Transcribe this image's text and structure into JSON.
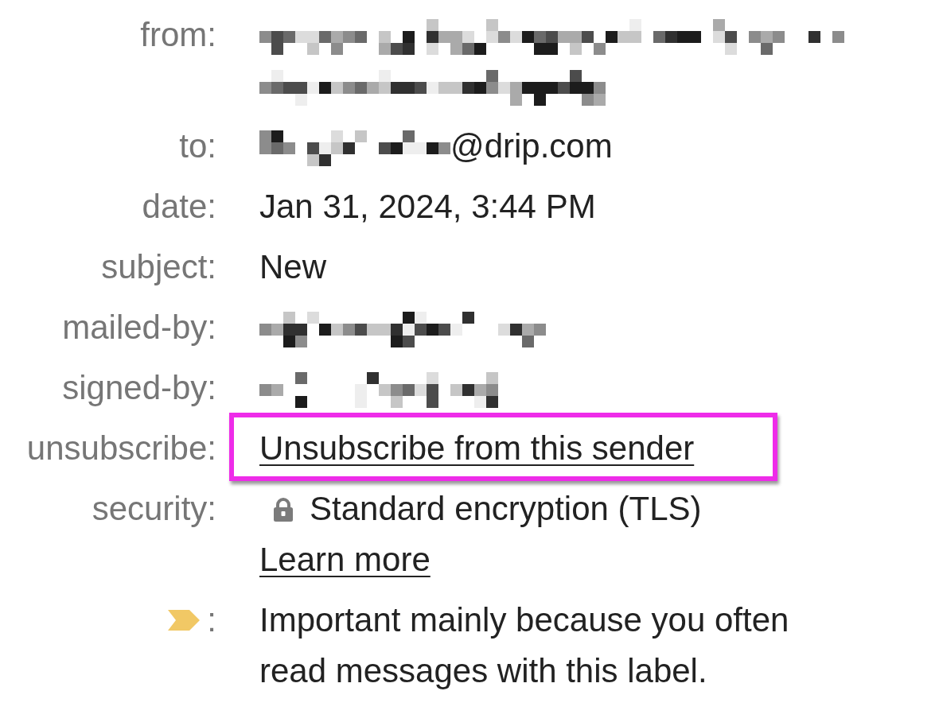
{
  "rows": [
    {
      "kind": "field",
      "label": "from:",
      "highlighted": false,
      "value": [
        {
          "kind": "redacted"
        },
        {
          "kind": "redacted"
        }
      ]
    },
    {
      "kind": "field",
      "label": "to:",
      "highlighted": false,
      "value": [
        {
          "kind": "redacted"
        },
        {
          "kind": "text",
          "text": "@drip.com"
        }
      ]
    },
    {
      "kind": "field",
      "label": "date:",
      "highlighted": false,
      "value": [
        {
          "kind": "text",
          "text": "Jan 31, 2024, 3:44 PM"
        }
      ]
    },
    {
      "kind": "field",
      "label": "subject:",
      "highlighted": false,
      "value": [
        {
          "kind": "text",
          "text": "New"
        }
      ]
    },
    {
      "kind": "field",
      "label": "mailed-by:",
      "highlighted": false,
      "value": [
        {
          "kind": "redacted"
        }
      ]
    },
    {
      "kind": "field",
      "label": "signed-by:",
      "highlighted": false,
      "value": [
        {
          "kind": "redacted"
        }
      ]
    },
    {
      "kind": "field",
      "label": "unsubscribe:",
      "highlighted": true,
      "value": [
        {
          "kind": "link",
          "text": "Unsubscribe from this sender"
        }
      ]
    },
    {
      "kind": "security",
      "label": "security:",
      "highlighted": false,
      "value": [
        {
          "kind": "text",
          "text": "Standard encryption (TLS)"
        },
        {
          "kind": "link",
          "text": "Learn more"
        }
      ]
    },
    {
      "kind": "importance",
      "label": ":",
      "highlighted": false,
      "value": [
        {
          "kind": "text",
          "text": "Important mainly because you often read messages with this label."
        }
      ]
    }
  ]
}
